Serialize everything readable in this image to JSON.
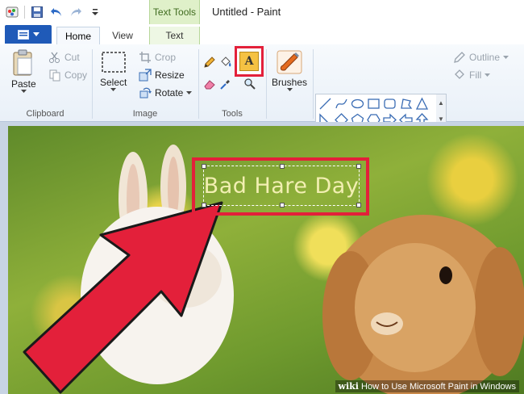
{
  "window": {
    "title": "Untitled - Paint",
    "context_tab_header": "Text Tools"
  },
  "tabs": [
    {
      "label": "Home"
    },
    {
      "label": "View"
    },
    {
      "label": "Text"
    }
  ],
  "ribbon": {
    "clipboard": {
      "label": "Clipboard",
      "paste": "Paste",
      "cut": "Cut",
      "copy": "Copy"
    },
    "image": {
      "label": "Image",
      "select": "Select",
      "crop": "Crop",
      "resize": "Resize",
      "rotate": "Rotate"
    },
    "tools": {
      "label": "Tools"
    },
    "brushes": {
      "label": "Brushes"
    },
    "shapes": {
      "label": "Shapes",
      "outline": "Outline",
      "fill": "Fill"
    }
  },
  "canvas": {
    "text": "Bad Hare Day"
  },
  "watermark": {
    "brand": "wiki",
    "text": "How to Use Microsoft Paint in Windows"
  },
  "colors": {
    "accent": "#1f5ab8",
    "highlight": "#e3203a",
    "arrow": "#e3203a",
    "context_tab": "#dff0c9"
  }
}
